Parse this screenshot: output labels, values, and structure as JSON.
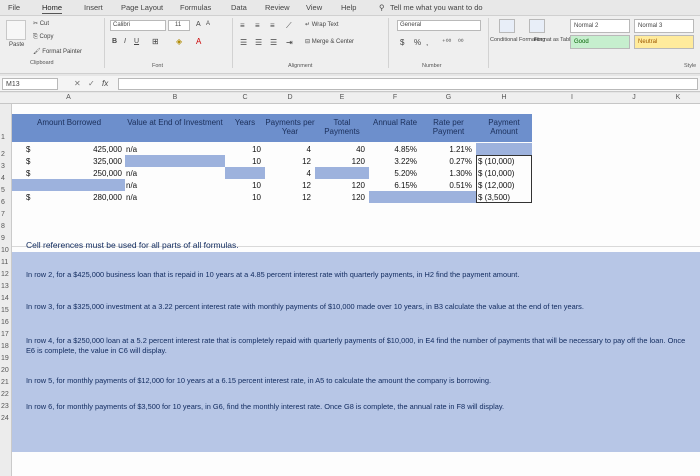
{
  "tabs": [
    "File",
    "Home",
    "Insert",
    "Page Layout",
    "Formulas",
    "Data",
    "Review",
    "View",
    "Help"
  ],
  "tell_me": "Tell me what you want to do",
  "clipboard": {
    "cut": "Cut",
    "copy": "Copy",
    "paste": "Paste",
    "format_painter": "Format Painter",
    "group": "Clipboard"
  },
  "font": {
    "name": "Calibri",
    "size": "11",
    "bold": "B",
    "italic": "I",
    "underline": "U",
    "grow": "A",
    "shrink": "A",
    "group": "Font"
  },
  "alignment": {
    "wrap": "Wrap Text",
    "merge": "Merge & Center",
    "group": "Alignment"
  },
  "number": {
    "format": "General",
    "currency": "$",
    "percent": "%",
    "comma": ",",
    "group": "Number"
  },
  "styles": {
    "conditional": "Conditional Formatting",
    "format_table": "Format as Table",
    "normal2": "Normal 2",
    "normal3": "Normal 3",
    "good": "Good",
    "neutral": "Neutral",
    "group": "Style"
  },
  "name_box": "M13",
  "fx": "fx",
  "columns": [
    "A",
    "B",
    "C",
    "D",
    "E",
    "F",
    "G",
    "H",
    "I",
    "J",
    "K"
  ],
  "rows": [
    "1",
    "2",
    "3",
    "4",
    "5",
    "6",
    "7",
    "8",
    "9",
    "10",
    "11",
    "12",
    "13",
    "14",
    "15",
    "16",
    "17",
    "18",
    "19",
    "20",
    "21",
    "22",
    "23",
    "24"
  ],
  "headers": {
    "a": "Amount Borrowed",
    "b": "Value at End of Investment",
    "c": "Years",
    "d": "Payments per Year",
    "e": "Total Payments",
    "f": "Annual Rate",
    "g": "Rate per Payment",
    "h": "Payment Amount"
  },
  "data_rows": [
    {
      "a_sym": "$",
      "a": "425,000",
      "b": "n/a",
      "c": "10",
      "d": "4",
      "e": "40",
      "f": "4.85%",
      "g": "1.21%",
      "h": ""
    },
    {
      "a_sym": "$",
      "a": "325,000",
      "b": "",
      "c": "10",
      "d": "12",
      "e": "120",
      "f": "3.22%",
      "g": "0.27%",
      "h": "$ (10,000)"
    },
    {
      "a_sym": "$",
      "a": "250,000",
      "b": "n/a",
      "c": "",
      "d": "4",
      "e": "",
      "f": "5.20%",
      "g": "1.30%",
      "h": "$ (10,000)"
    },
    {
      "a_sym": "",
      "a": "",
      "b": "n/a",
      "c": "10",
      "d": "12",
      "e": "120",
      "f": "6.15%",
      "g": "0.51%",
      "h": "$ (12,000)"
    },
    {
      "a_sym": "$",
      "a": "280,000",
      "b": "n/a",
      "c": "10",
      "d": "12",
      "e": "120",
      "f": "",
      "g": "",
      "h": "$   (3,500)"
    }
  ],
  "instructions": {
    "intro": "Cell references must be used for all parts of all formulas.",
    "p1": "In row 2, for a $425,000 business loan that is repaid in 10 years at a 4.85 percent interest rate with quarterly payments, in H2 find the payment amount.",
    "p2": "In row 3, for a $325,000 investment at a 3.22 percent interest rate with monthly payments of $10,000 made over 10 years, in B3 calculate the value at the end of ten years.",
    "p3": "In row 4, for a $250,000 loan at a 5.2 percent interest rate that is completely repaid with quarterly payments of $10,000, in E4 find the number of payments that will be necessary to pay off the loan. Once E6 is complete, the value in C6 will display.",
    "p4": "In row 5, for monthly payments of $12,000 for 10 years at a 6.15 percent interest rate, in A5 to calculate the amount the company is borrowing.",
    "p5": "In row 6, for monthly payments of $3,500 for 10 years, in G6, find the monthly interest rate. Once G8 is complete, the annual rate in F8 will display."
  }
}
